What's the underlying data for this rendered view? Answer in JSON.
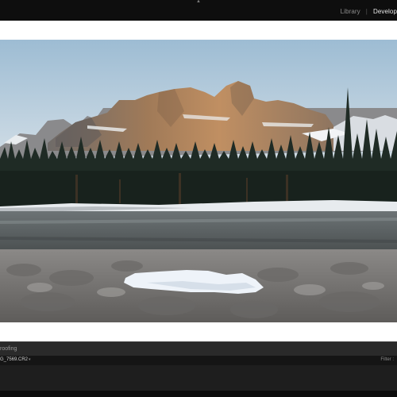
{
  "top_bar": {
    "collapse_icon": "triangle-up-icon",
    "modules": [
      {
        "label": "Library",
        "active": false
      },
      {
        "label": "Develop",
        "active": true
      }
    ],
    "separator": "|"
  },
  "photo": {
    "subject": "mountain-river-landscape",
    "colors": {
      "sky_top": "#a9c4d8",
      "sky_bottom": "#dfe6ea",
      "rock_lit": "#b88a5e",
      "rock_shadow": "#6d6a68",
      "snow": "#f2f4f6",
      "forest": "#1e2a24",
      "river": "#5e6466",
      "stones": "#7d7c7a",
      "ice": "#e8eef6"
    }
  },
  "toolbar": {
    "soft_proofing_label": "roofing"
  },
  "filmstrip": {
    "filename": "G_7569.CR2",
    "filename_arrow_icon": "caret-down-icon",
    "filter_label": "Filter :"
  }
}
